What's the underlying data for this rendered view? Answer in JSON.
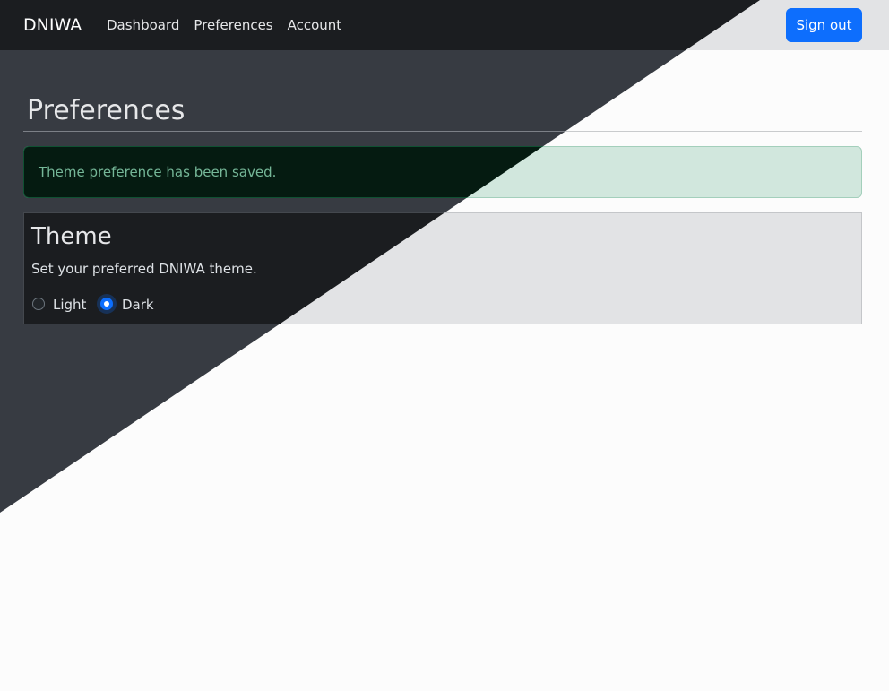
{
  "navbar": {
    "brand": "DNIWA",
    "links": [
      "Dashboard",
      "Preferences",
      "Account"
    ],
    "signout_label": "Sign out"
  },
  "page": {
    "title": "Preferences"
  },
  "alert": {
    "message": "Theme preference has been saved.",
    "type": "success"
  },
  "theme_card": {
    "title": "Theme",
    "description": "Set your preferred DNIWA theme.",
    "options": [
      {
        "label": "Light",
        "checked": false
      },
      {
        "label": "Dark",
        "checked": true
      }
    ]
  },
  "colors": {
    "primary": "#0d6efd",
    "dark_bg": "#373b42",
    "light_bg": "#fcfcfc",
    "success_bg_light": "#d1e7dd",
    "success_bg_dark": "#051b11"
  }
}
